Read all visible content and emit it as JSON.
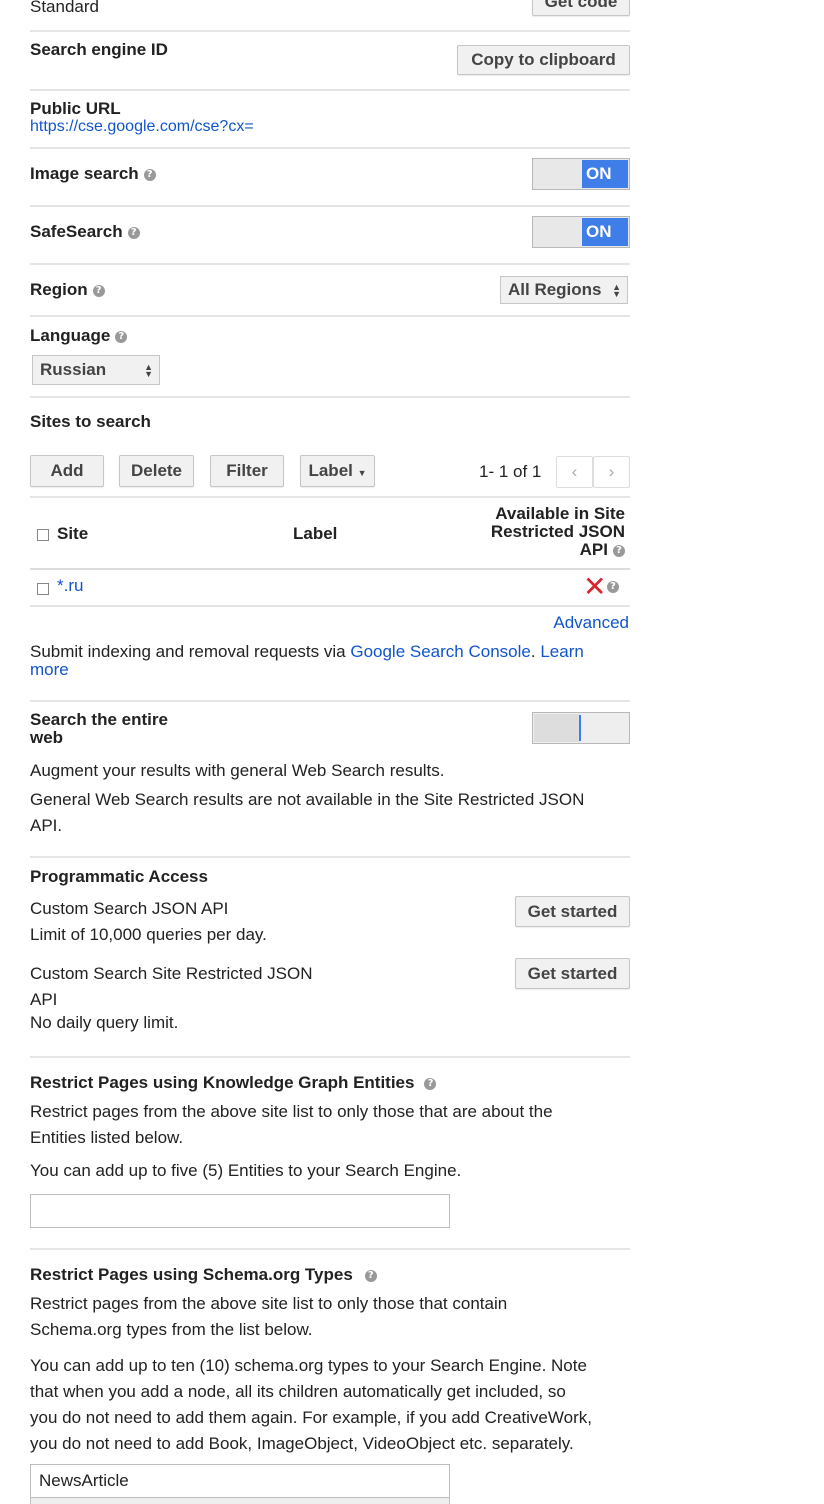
{
  "edition": {
    "value": "Standard",
    "get_code_label": "Get code"
  },
  "search_engine_id": {
    "label": "Search engine ID",
    "copy_label": "Copy to clipboard"
  },
  "public_url": {
    "label": "Public URL",
    "url": "https://cse.google.com/cse?cx="
  },
  "image_search": {
    "label": "Image search",
    "state": "ON"
  },
  "safesearch": {
    "label": "SafeSearch",
    "state": "ON"
  },
  "region": {
    "label": "Region",
    "value": "All Regions"
  },
  "language": {
    "label": "Language",
    "value": "Russian"
  },
  "sites": {
    "title": "Sites to search",
    "buttons": {
      "add": "Add",
      "delete": "Delete",
      "filter": "Filter",
      "label": "Label"
    },
    "pagination": "1- 1 of 1",
    "columns": {
      "site": "Site",
      "label": "Label",
      "available_line1": "Available in Site",
      "available_line2": "Restricted JSON",
      "available_line3": "API"
    },
    "rows": [
      {
        "site": "*.ru",
        "label": "",
        "available": "✕"
      }
    ],
    "advanced": "Advanced"
  },
  "indexing": {
    "prefix": "Submit indexing and removal requests via ",
    "console_link": "Google Search Console",
    "dot": ".",
    "learn": "Learn",
    "more": "more"
  },
  "entire_web": {
    "label_line1": "Search the entire",
    "label_line2": "web",
    "desc1": "Augment your results with general Web Search results.",
    "desc2_line1": "General Web Search results are not available in the Site Restricted JSON",
    "desc2_line2": "API."
  },
  "programmatic": {
    "title": "Programmatic Access",
    "json_api": {
      "name": "Custom Search JSON API",
      "limit": "Limit of 10,000 queries per day.",
      "button": "Get started"
    },
    "restricted_api": {
      "name_line1": "Custom Search Site Restricted JSON",
      "name_line2": "API",
      "limit": "No daily query limit.",
      "button": "Get started"
    }
  },
  "knowledge_graph": {
    "title": "Restrict Pages using Knowledge Graph Entities",
    "desc_line1": "Restrict pages from the above site list to only those that are about the",
    "desc_line2": "Entities listed below.",
    "note": "You can add up to five (5) Entities to your Search Engine.",
    "input_value": ""
  },
  "schema": {
    "title": "Restrict Pages using Schema.org Types",
    "desc_line1": "Restrict pages from the above site list to only those that contain",
    "desc_line2": "Schema.org types from the list below.",
    "note_line1": "You can add up to ten (10) schema.org types to your Search Engine. Note",
    "note_line2": "that when you add a node, all its children automatically get included, so",
    "note_line3": "you do not need to add them again. For example, if you add CreativeWork,",
    "note_line4": "you do not need to add Book, ImageObject, VideoObject etc. separately.",
    "input_value": "NewsArticle"
  },
  "colors": {
    "accent": "#3f7ee8",
    "link": "#1155cc",
    "error": "#d9232d"
  }
}
